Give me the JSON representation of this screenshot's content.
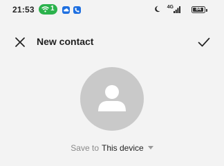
{
  "status_bar": {
    "time": "21:53",
    "wifi_hotspot_count": "1",
    "network_label": "4G",
    "battery_level": "84",
    "icons": [
      "wifi-hotspot-icon",
      "cloud-app-icon",
      "phone-app-icon",
      "moon-icon",
      "signal-icon",
      "battery-icon"
    ],
    "colors": {
      "hotspot_pill": "#2bb24c",
      "app_icon": "#1e6fe0"
    }
  },
  "header": {
    "title": "New contact",
    "close_icon": "close-icon",
    "confirm_icon": "check-icon"
  },
  "avatar": {
    "icon": "person-icon",
    "background": "#c9c9c9"
  },
  "save_to": {
    "label": "Save to",
    "value": "This device",
    "caret_icon": "dropdown-caret-icon"
  }
}
